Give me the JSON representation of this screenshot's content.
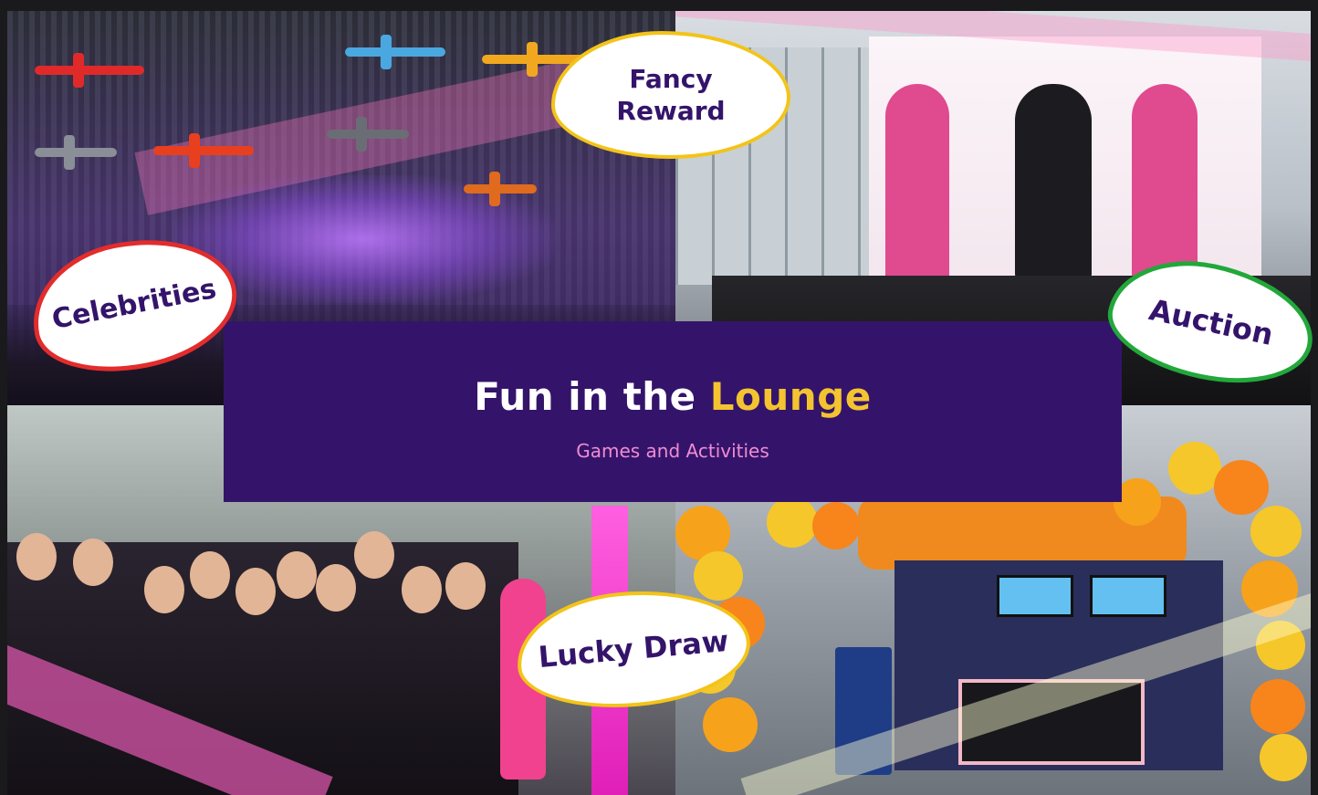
{
  "title": {
    "main": "Fun in the ",
    "accent": "Lounge",
    "subtitle": "Games and Activities"
  },
  "badges": {
    "fancy_reward": "Fancy\nReward",
    "celebrities": "Celebrities",
    "auction": "Auction",
    "lucky_draw": "Lucky Draw"
  },
  "colors": {
    "panel_bg": "#34146a",
    "title_text": "#ffffff",
    "title_accent": "#f4c430",
    "subtitle_text": "#f08cd3",
    "badge_text": "#34146a",
    "badge_border_fancy": "#f3c418",
    "badge_border_celebrities": "#e32c2c",
    "badge_border_auction": "#22a83a",
    "badge_border_lucky": "#f3c418"
  },
  "images": {
    "top_left": "airport-hangar-party-photo",
    "top_right": "dj-stage-photo",
    "bottom_left": "flight-crew-group-photo",
    "bottom_right": "dia-de-los-muertos-gate-photo"
  }
}
